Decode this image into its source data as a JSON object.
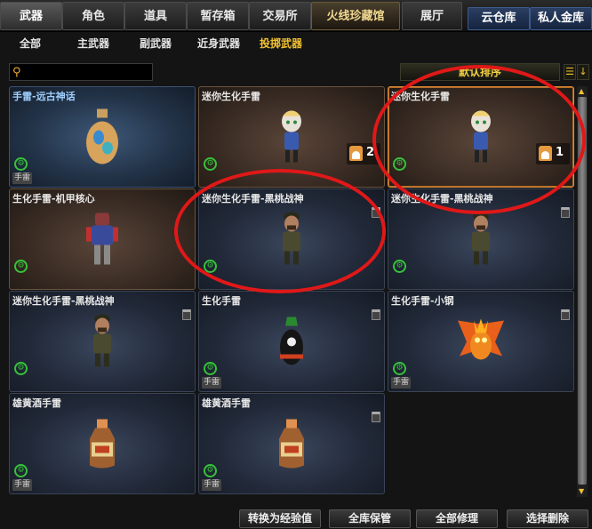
{
  "top_tabs": [
    {
      "label": "武器",
      "active": true
    },
    {
      "label": "角色"
    },
    {
      "label": "道具"
    },
    {
      "label": "暂存箱"
    },
    {
      "label": "交易所"
    },
    {
      "label": "火线珍藏馆"
    },
    {
      "label": "展厅"
    },
    {
      "label": "云仓库"
    },
    {
      "label": "私人金库"
    }
  ],
  "sub_tabs": [
    {
      "label": "全部"
    },
    {
      "label": "主武器"
    },
    {
      "label": "副武器"
    },
    {
      "label": "近身武器"
    },
    {
      "label": "投掷武器",
      "active": true
    }
  ],
  "search": {
    "value": "",
    "placeholder": ""
  },
  "sort": {
    "label": "默认排序"
  },
  "items": [
    {
      "title": "手雷-远古神话",
      "tag": "手雷",
      "style": "blue1",
      "art": "egg-grenade-icon",
      "deletable": false
    },
    {
      "title": "迷你生化手雷",
      "tag": "",
      "style": "brown",
      "art": "mini-figure-icon",
      "count": "2",
      "deletable": false
    },
    {
      "title": "迷你生化手雷",
      "tag": "",
      "style": "brown",
      "art": "mini-figure-icon",
      "count": "1",
      "deletable": false
    },
    {
      "title": "生化手雷-机甲核心",
      "tag": "",
      "style": "brown",
      "art": "mecha-figure-icon",
      "deletable": false
    },
    {
      "title": "迷你生化手雷-黑桃战神",
      "tag": "",
      "style": "blue",
      "art": "soldier-figure-icon",
      "deletable": true
    },
    {
      "title": "迷你生化手雷-黑桃战神",
      "tag": "",
      "style": "blue",
      "art": "soldier-figure-icon",
      "deletable": true
    },
    {
      "title": "迷你生化手雷-黑桃战神",
      "tag": "",
      "style": "blue",
      "art": "soldier-figure-icon",
      "deletable": true
    },
    {
      "title": "生化手雷",
      "tag": "手雷",
      "style": "blue",
      "art": "skull-grenade-icon",
      "deletable": true
    },
    {
      "title": "生化手雷-小钢",
      "tag": "手雷",
      "style": "blue",
      "art": "fire-demon-icon",
      "deletable": true
    },
    {
      "title": "雄黄酒手雷",
      "tag": "手雷",
      "style": "blue",
      "art": "wine-bottle-icon",
      "deletable": false
    },
    {
      "title": "雄黄酒手雷",
      "tag": "手雷",
      "style": "blue",
      "art": "wine-bottle-icon",
      "deletable": true
    }
  ],
  "buttons": {
    "convert": "转换为经验值",
    "vault_store": "全库保管",
    "repair_all": "全部修理",
    "select_delete": "选择删除"
  },
  "colors": {
    "accent": "#f2c232",
    "annotation": "#e01818",
    "badge": "#36c23a"
  }
}
